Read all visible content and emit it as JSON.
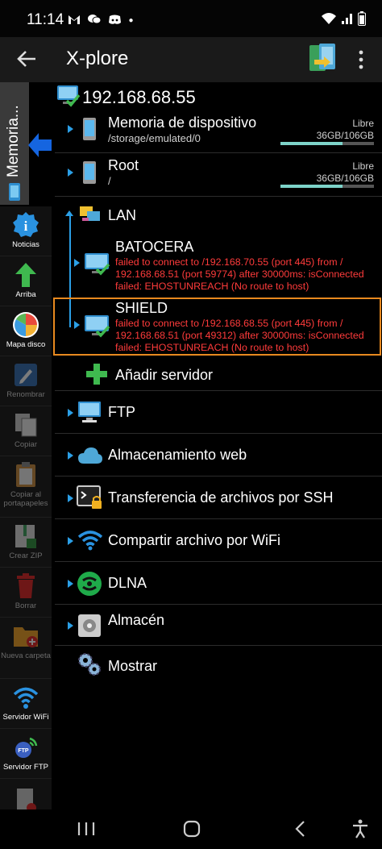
{
  "status": {
    "time": "11:14",
    "left_icons": "M ●",
    "battery_icon": "battery-icon"
  },
  "appbar": {
    "title": "X-plore"
  },
  "side_tab": {
    "label": "Memoria..."
  },
  "toolbar": [
    {
      "id": "noticias",
      "label": "Noticias",
      "enabled": true
    },
    {
      "id": "arriba",
      "label": "Arriba",
      "enabled": true
    },
    {
      "id": "mapa",
      "label": "Mapa disco",
      "enabled": true
    },
    {
      "id": "renombrar",
      "label": "Renombrar",
      "enabled": false
    },
    {
      "id": "copiar",
      "label": "Copiar",
      "enabled": false
    },
    {
      "id": "copiar-portapapeles",
      "label": "Copiar al portapapeles",
      "enabled": false
    },
    {
      "id": "crear-zip",
      "label": "Crear ZIP",
      "enabled": false
    },
    {
      "id": "borrar",
      "label": "Borrar",
      "enabled": false
    },
    {
      "id": "nueva-carpeta",
      "label": "Nueva carpeta",
      "enabled": false
    },
    {
      "id": "servidor-wifi",
      "label": "Servidor WiFi",
      "enabled": true
    },
    {
      "id": "servidor-ftp",
      "label": "Servidor FTP",
      "enabled": true
    }
  ],
  "tree": {
    "root": "192.168.68.55",
    "device": {
      "title": "Memoria de dispositivo",
      "path": "/storage/emulated/0",
      "free_label": "Libre",
      "free_value": "36GB/106GB",
      "used_fraction": 0.66
    },
    "root_fs": {
      "title": "Root",
      "path": "/",
      "free_label": "Libre",
      "free_value": "36GB/106GB",
      "used_fraction": 0.66
    },
    "lan": {
      "title": "LAN"
    },
    "batocera": {
      "title": "BATOCERA",
      "error": [
        "failed to connect to /192.168.70.55 (port 445) from /",
        "192.168.68.51 (port 59774) after 30000ms: isConnected",
        "failed: EHOSTUNREACH (No route to host)"
      ]
    },
    "shield": {
      "title": "SHIELD",
      "error": [
        "failed to connect to /192.168.68.55 (port 445) from /",
        "192.168.68.51 (port 49312) after 30000ms: isConnected",
        "failed: EHOSTUNREACH (No route to host)"
      ]
    },
    "add_server": "Añadir servidor",
    "ftp": "FTP",
    "web_storage": "Almacenamiento web",
    "ssh": "Transferencia de archivos por SSH",
    "wifi_share": "Compartir archivo por WiFi",
    "dlna": "DLNA",
    "storage": "Almacén",
    "show": "Mostrar"
  },
  "colors": {
    "accent_blue": "#2b9fe6",
    "error_red": "#ff3b3b",
    "highlight_orange": "#e8891f",
    "bar_fill": "#7dd3c9"
  }
}
